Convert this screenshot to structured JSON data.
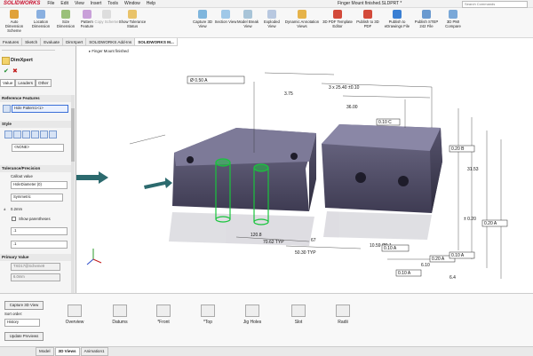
{
  "app": {
    "name": "SOLIDWORKS",
    "menu": [
      "File",
      "Edit",
      "View",
      "Insert",
      "Tools",
      "Window",
      "Help"
    ],
    "document_title": "Finger Mount finished.SLDPRT *",
    "search_placeholder": "Search Commands"
  },
  "ribbon": {
    "buttons": [
      {
        "label": "Auto Dimension Scheme",
        "icon": "auto-dimension-icon"
      },
      {
        "label": "Location Dimension",
        "icon": "location-dimension-icon"
      },
      {
        "label": "Size Dimension",
        "icon": "size-dimension-icon"
      },
      {
        "label": "Pattern Feature",
        "icon": "pattern-feature-icon"
      },
      {
        "label": "Copy Scheme",
        "icon": "copy-scheme-icon"
      },
      {
        "label": "Show Tolerance Status",
        "icon": "tolerance-status-icon"
      },
      {
        "label": "Capture 3D View",
        "icon": "capture-3d-icon"
      },
      {
        "label": "Section View",
        "icon": "section-view-icon"
      },
      {
        "label": "Model Break View",
        "icon": "model-break-icon"
      },
      {
        "label": "Exploded View",
        "icon": "exploded-view-icon"
      },
      {
        "label": "Dynamic Annotation Views",
        "icon": "annotation-views-icon"
      },
      {
        "label": "3D PDF Template Editor",
        "icon": "pdf-template-icon"
      },
      {
        "label": "Publish to 3D PDF",
        "icon": "publish-pdf-icon"
      },
      {
        "label": "Publish to eDrawings File",
        "icon": "edrawings-icon"
      },
      {
        "label": "Publish STEP 242 File",
        "icon": "step-icon"
      },
      {
        "label": "3D PMI Compare",
        "icon": "pmi-compare-icon"
      }
    ]
  },
  "command_tabs": [
    "Features",
    "Sketch",
    "Evaluate",
    "DimXpert",
    "SOLIDWORKS Add-Ins",
    "SOLIDWORKS M..."
  ],
  "property_manager": {
    "title": "DimXpert",
    "tabs": [
      "Value",
      "Leaders",
      "Other"
    ],
    "reference_features": {
      "heading": "Reference Features",
      "value": "Hole Pattern1<1>"
    },
    "style": {
      "heading": "Style",
      "value": "<NONE>"
    },
    "tolerance": {
      "heading": "Tolerance/Precision",
      "callout_label": "Callout value",
      "callout_value": "HoleDiameter (0)",
      "type": "Symmetric",
      "value": "0.2mm",
      "show_parentheses": "Show parentheses",
      "precision1": ".1",
      "precision2": ".1"
    },
    "primary_value": {
      "heading": "Primary Value",
      "field1": "TXD17@Scheme9",
      "field2": "6.0mm"
    }
  },
  "tree": {
    "node": "Finger Mount finished"
  },
  "annotations": {
    "dims": [
      "3 x 25.40 ±0.10",
      "36.00",
      "3.75",
      "70.62 TYP",
      "50.30 TYP",
      "120.8",
      "67",
      "6.4",
      "± 0.20",
      "31.53",
      "10.59 Ø0.1",
      "6.10"
    ],
    "frames": [
      "Ø 0.50 A",
      "0.10 C",
      "0.10 A",
      "0.20 A",
      "0.20 A",
      "0.10 A",
      "0.10 A",
      "0.20 B"
    ]
  },
  "bottom_panel": {
    "buttons": [
      "Capture 3D View",
      "Update Previews"
    ],
    "sort_label": "Sort order:",
    "sort_value": "History",
    "views": [
      "Overview",
      "Datums",
      "*Front",
      "*Top",
      "Jig Holes",
      "Slot",
      "Radii"
    ]
  },
  "status_tabs": [
    "Model",
    "3D Views",
    "Animation1"
  ],
  "colors": {
    "accent": "#c8102e",
    "model": "#4e4b63",
    "highlight": "#19c43d",
    "arrow": "#2c6a6e"
  }
}
